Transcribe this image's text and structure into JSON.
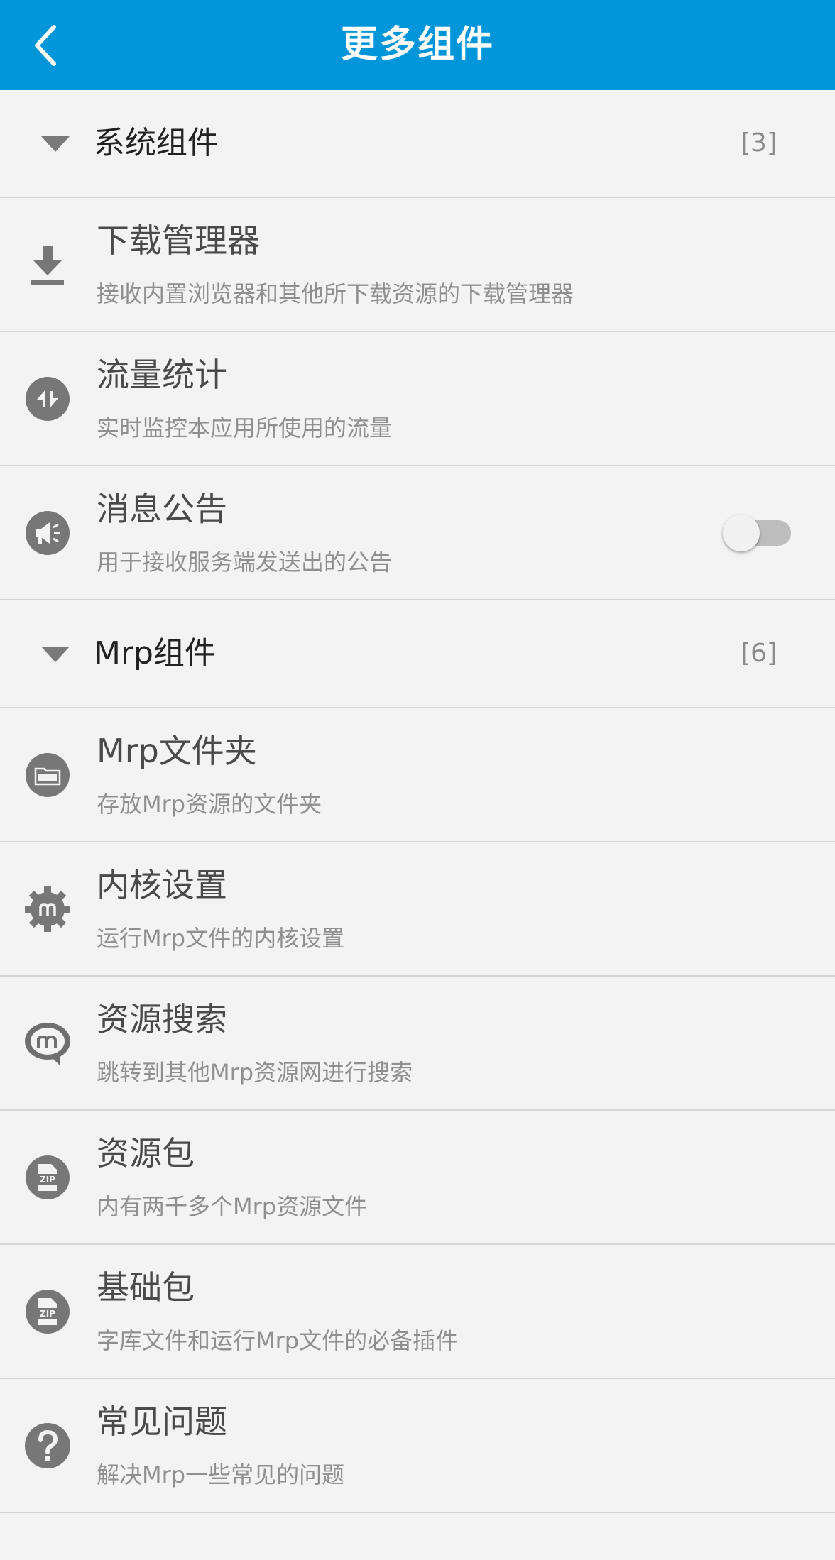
{
  "appbar": {
    "title": "更多组件",
    "background": "#0096d9"
  },
  "groups": [
    {
      "title": "系统组件",
      "count": "[3]",
      "items": [
        {
          "icon": "download-icon",
          "title": "下载管理器",
          "subtitle": "接收内置浏览器和其他所下载资源的下载管理器"
        },
        {
          "icon": "traffic-icon",
          "title": "流量统计",
          "subtitle": "实时监控本应用所使用的流量"
        },
        {
          "icon": "megaphone-icon",
          "title": "消息公告",
          "subtitle": "用于接收服务端发送出的公告",
          "toggle": "off"
        }
      ]
    },
    {
      "title": "Mrp组件",
      "count": "[6]",
      "items": [
        {
          "icon": "mrp-folder-icon",
          "title": "Mrp文件夹",
          "subtitle": "存放Mrp资源的文件夹"
        },
        {
          "icon": "gear-icon",
          "title": "内核设置",
          "subtitle": "运行Mrp文件的内核设置"
        },
        {
          "icon": "search-bubble-icon",
          "title": "资源搜索",
          "subtitle": "跳转到其他Mrp资源网进行搜索"
        },
        {
          "icon": "zip-icon",
          "title": "资源包",
          "subtitle": "内有两千多个Mrp资源文件"
        },
        {
          "icon": "zip-icon",
          "title": "基础包",
          "subtitle": "字库文件和运行Mrp文件的必备插件"
        },
        {
          "icon": "question-icon",
          "title": "常见问题",
          "subtitle": "解决Mrp一些常见的问题"
        }
      ]
    }
  ]
}
